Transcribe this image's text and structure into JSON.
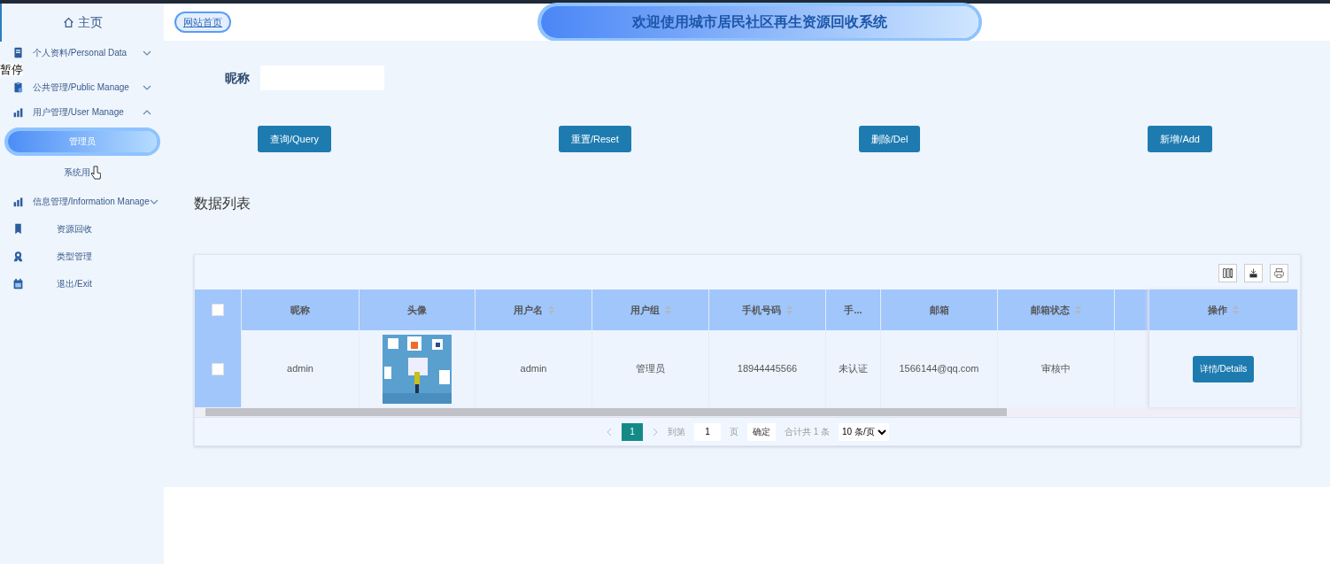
{
  "sidebar": {
    "home": "主页",
    "items": [
      {
        "kind": "group",
        "label": "个人资料/Personal Data",
        "expanded": false
      },
      {
        "kind": "group",
        "label": "公共管理/Public Manage",
        "expanded": false
      },
      {
        "kind": "group",
        "label": "用户管理/User Manage",
        "expanded": true
      },
      {
        "kind": "sub",
        "label": "管理员",
        "selected": true
      },
      {
        "kind": "sub",
        "label": "系统用",
        "selected": false
      },
      {
        "kind": "group",
        "label": "信息管理/Information Manage",
        "expanded": false
      },
      {
        "kind": "leaf",
        "label": "资源回收"
      },
      {
        "kind": "leaf",
        "label": "类型管理"
      },
      {
        "kind": "leaf",
        "label": "退出/Exit"
      }
    ]
  },
  "overlay_label": "暂停",
  "header": {
    "home_link": "网站首页",
    "title": "欢迎使用城市居民社区再生资源回收系统"
  },
  "search": {
    "label": "昵称"
  },
  "actions": [
    "查询/Query",
    "重置/Reset",
    "删除/Del",
    "新增/Add"
  ],
  "section_title": "数据列表",
  "table": {
    "select_all_checked": false,
    "columns": [
      {
        "label": "昵称",
        "sortable": false
      },
      {
        "label": "头像",
        "sortable": false
      },
      {
        "label": "用户名",
        "sortable": true
      },
      {
        "label": "用户组",
        "sortable": true
      },
      {
        "label": "手机号码",
        "sortable": true
      },
      {
        "label": "手...",
        "sortable": false
      },
      {
        "label": "邮箱",
        "sortable": false
      },
      {
        "label": "邮箱状态",
        "sortable": true
      }
    ],
    "action_column": {
      "label": "操作",
      "sortable": true
    },
    "rows": [
      {
        "checked": false,
        "cells": [
          "admin",
          {
            "kind": "picture"
          },
          "admin",
          "管理员",
          "18944445566",
          "未认证",
          "1566144@qq.com",
          "审核中"
        ],
        "action": "详情/Details"
      }
    ]
  },
  "pagination": {
    "pages": [
      {
        "label": "1",
        "selected": true
      }
    ],
    "goto_label": "到第",
    "goto_value": "1",
    "page_suffix": "页",
    "confirm": "确定",
    "total": "合计共 1 条",
    "page_size": "10 条/页"
  }
}
